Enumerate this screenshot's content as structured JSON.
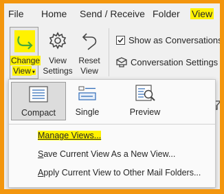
{
  "ribbon": {
    "tabs": [
      {
        "label": "File"
      },
      {
        "label": "Home"
      },
      {
        "label": "Send / Receive"
      },
      {
        "label": "Folder"
      },
      {
        "label": "View"
      }
    ],
    "change_view": {
      "line1": "Change",
      "line2": "View"
    },
    "view_settings": {
      "line1": "View",
      "line2": "Settings"
    },
    "reset_view": {
      "line1": "Reset",
      "line2": "View"
    },
    "show_as_conversations": {
      "label": "Show as Conversations",
      "checked": true
    },
    "conversation_settings": {
      "label": "Conversation Settings"
    }
  },
  "dropdown": {
    "views": [
      {
        "label": "Compact",
        "selected": true
      },
      {
        "label": "Single",
        "selected": false
      },
      {
        "label": "Preview",
        "selected": false
      }
    ],
    "menu": {
      "manage_views": "Manage Views...",
      "save_view_prefix": "",
      "save_view_hotkey": "S",
      "save_view_rest": "ave Current View As a New View...",
      "apply_view_hotkey": "A",
      "apply_view_rest": "pply Current View to Other Mail Folders..."
    }
  },
  "colors": {
    "highlight": "#fff200",
    "border": "#f3960e",
    "accent_green": "#46a93b",
    "icon_blue": "#2e6bb8"
  }
}
